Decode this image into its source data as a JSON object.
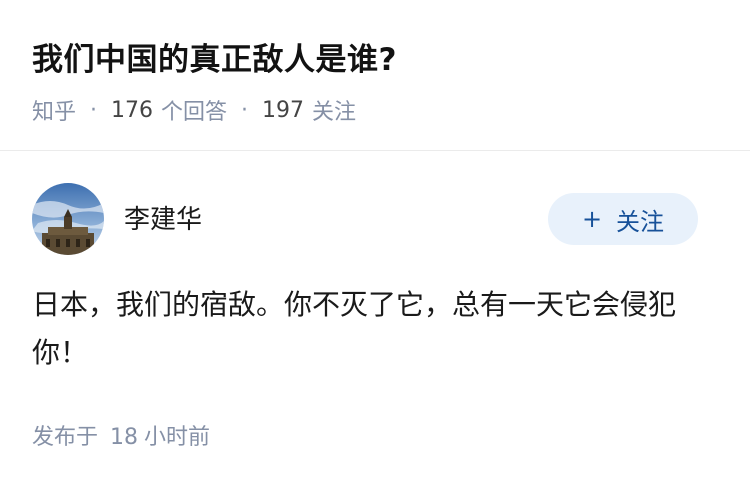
{
  "question": {
    "title": "我们中国的真正敌人是谁?",
    "source": "知乎",
    "answer_count": "176",
    "answer_label": "个回答",
    "follower_count": "197",
    "follower_label": "关注"
  },
  "answer": {
    "author": "李建华",
    "follow_button_label": "关注",
    "follow_button_icon": "plus-icon",
    "content": "日本，我们的宿敌。你不灭了它，总有一天它会侵犯你！",
    "published_prefix": "发布于",
    "published_value": "18",
    "published_unit": "小时前"
  },
  "colors": {
    "accent": "#175199",
    "button_bg": "#e8f1fb",
    "meta_text": "#8590a6"
  }
}
